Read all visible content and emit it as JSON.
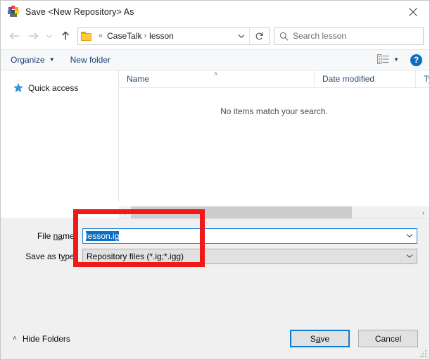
{
  "window": {
    "title": "Save <New Repository> As",
    "app_icon": "casetalk-logo-icon",
    "close_label": "Close"
  },
  "nav": {
    "back": "Back",
    "forward": "Forward",
    "recent": "Recent locations",
    "up": "Up one level",
    "refresh": "Refresh"
  },
  "address": {
    "folder_icon": "folder-icon",
    "overflow": "«",
    "crumb1": "CaseTalk",
    "separator": "›",
    "crumb2": "lesson",
    "dropdown": "⌄"
  },
  "search": {
    "placeholder": "Search lesson",
    "value": "",
    "icon": "search-icon"
  },
  "commandbar": {
    "organize": "Organize",
    "new_folder": "New folder",
    "view_icon": "view-options-icon",
    "help": "?"
  },
  "sidebar": {
    "items": [
      {
        "label": "Quick access",
        "icon": "star-icon"
      }
    ]
  },
  "filelist": {
    "columns": [
      {
        "label": "Name",
        "sorted": true,
        "sort_caret": "˄"
      },
      {
        "label": "Date modified",
        "sorted": false
      },
      {
        "label": "Type",
        "sorted": false
      }
    ],
    "empty_message": "No items match your search.",
    "scrollbar": {
      "left_arrow": "‹",
      "right_arrow": "›"
    }
  },
  "form": {
    "filename_label_pre": "File ",
    "filename_label_mn": "na",
    "filename_label_post": "me:",
    "filename_value": "lesson.ig",
    "filetype_label_pre": "Save as t",
    "filetype_label_mn": "y",
    "filetype_label_post": "pe:",
    "filetype_value": "Repository files (*.ig;*.igg)",
    "dropdown_caret": "⌄"
  },
  "footer": {
    "hide_folders": "Hide Folders",
    "hide_chevron": "˄",
    "save_pre": "S",
    "save_mn": "a",
    "save_post": "ve",
    "cancel": "Cancel"
  },
  "annotation": {
    "type": "highlight-rectangle",
    "color": "#f01818"
  },
  "colors": {
    "accent": "#0b6fc8",
    "focus_border": "#0a7ad8",
    "annotation": "#f01818",
    "column_text": "#2b4a72",
    "command_text": "#1c3f6e"
  }
}
